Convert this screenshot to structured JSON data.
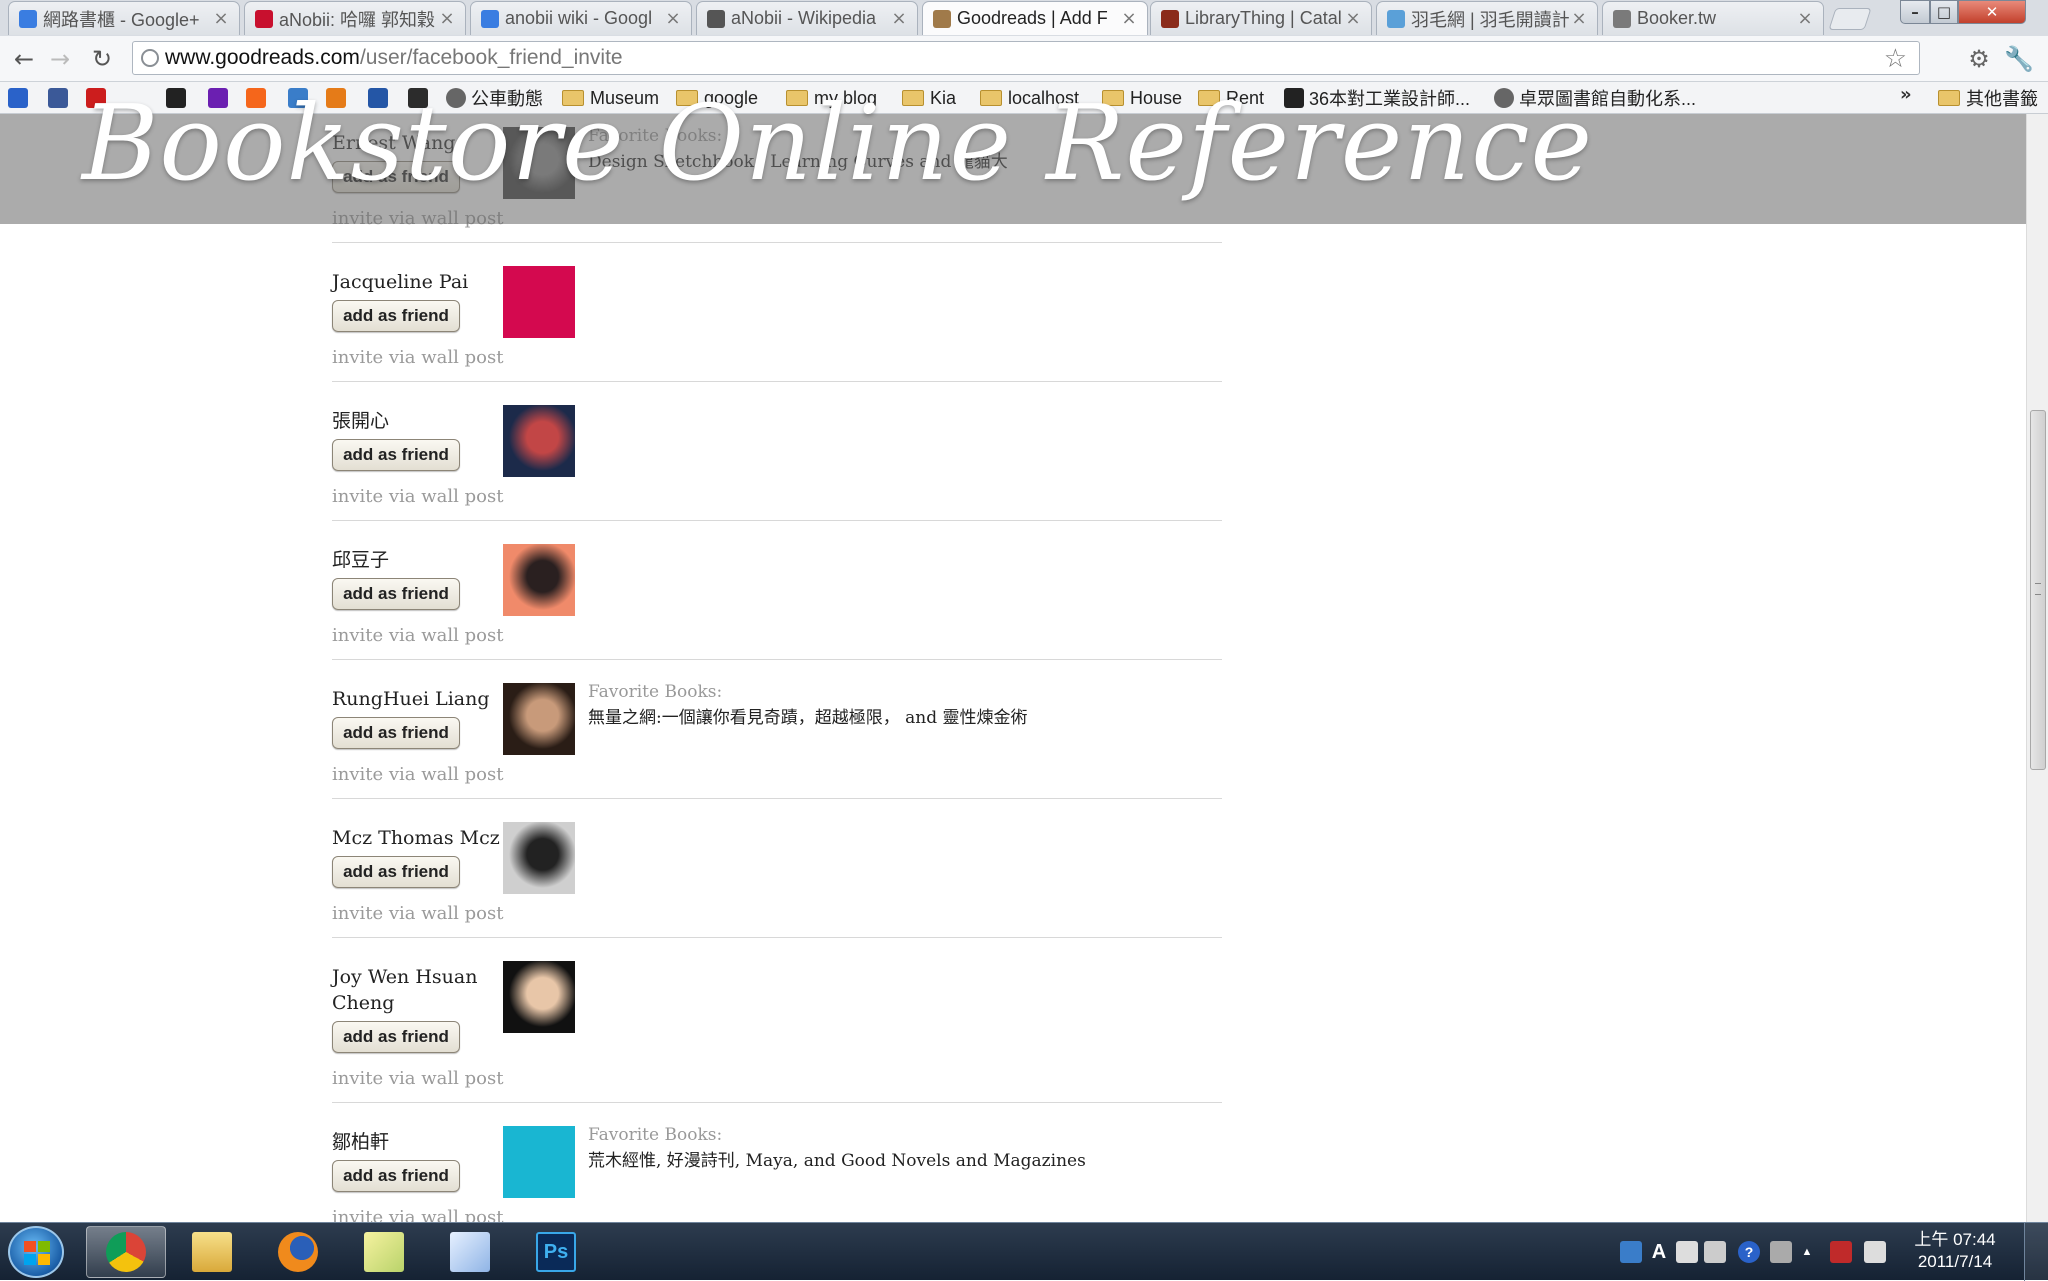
{
  "browser": {
    "tabs": [
      {
        "title": "網路書櫃 - Google+",
        "favicon": "google-icon",
        "color": "#3a7de1"
      },
      {
        "title": "aNobii: 哈囉 郭知穀",
        "favicon": "anobii-icon",
        "color": "#c8102e"
      },
      {
        "title": "anobii wiki - Googl",
        "favicon": "google-icon",
        "color": "#3a7de1"
      },
      {
        "title": "aNobii - Wikipedia",
        "favicon": "wikipedia-icon",
        "color": "#555555"
      },
      {
        "title": "Goodreads | Add F",
        "favicon": "goodreads-icon",
        "color": "#a07a4a",
        "active": true
      },
      {
        "title": "LibraryThing | Catal",
        "favicon": "librarything-icon",
        "color": "#8b2b1a"
      },
      {
        "title": "羽毛網 | 羽毛開讀計",
        "favicon": "feather-icon",
        "color": "#5aa0d8"
      },
      {
        "title": "Booker.tw",
        "favicon": "booker-icon",
        "color": "#7a7a7a"
      }
    ],
    "url_host": "www.goodreads.com",
    "url_path": "/user/facebook_friend_invite",
    "bookmarks": [
      {
        "label": "",
        "icon": "star-bookmark-icon",
        "color": "#2a62c9"
      },
      {
        "label": "",
        "icon": "facebook-icon",
        "color": "#3b5998"
      },
      {
        "label": "",
        "icon": "youtube-icon",
        "color": "#cc1d1d"
      },
      {
        "label": "",
        "icon": "lb-icon",
        "color": "#222222"
      },
      {
        "label": "",
        "icon": "yahoo-icon",
        "color": "#6b1fb1"
      },
      {
        "label": "",
        "icon": "soundcloud-icon",
        "color": "#f5661b"
      },
      {
        "label": "",
        "icon": "feather-bookmark-icon",
        "color": "#3a7dc9"
      },
      {
        "label": "",
        "icon": "fire-icon",
        "color": "#e57b18"
      },
      {
        "label": "",
        "icon": "badge-icon",
        "color": "#2456a6"
      },
      {
        "label": "",
        "icon": "dots-icon",
        "color": "#2c2c2c"
      },
      {
        "label": "公車動態",
        "icon": "globe-bookmark-icon",
        "color": "#666666"
      },
      {
        "label": "Museum",
        "icon": "folder-icon",
        "color": "#e9c56a"
      },
      {
        "label": "google",
        "icon": "folder-icon",
        "color": "#e9c56a"
      },
      {
        "label": "my blog",
        "icon": "folder-icon",
        "color": "#e9c56a"
      },
      {
        "label": "Kia",
        "icon": "folder-icon",
        "color": "#e9c56a"
      },
      {
        "label": "localhost",
        "icon": "folder-icon",
        "color": "#e9c56a"
      },
      {
        "label": "House",
        "icon": "folder-icon",
        "color": "#e9c56a"
      },
      {
        "label": "Rent",
        "icon": "folder-icon",
        "color": "#e9c56a"
      },
      {
        "label": "36本對工業設計師...",
        "icon": "amazon-icon",
        "color": "#222222"
      },
      {
        "label": "卓眾圖書館自動化系...",
        "icon": "globe-bookmark-icon",
        "color": "#666666"
      }
    ],
    "other_bookmarks": "其他書籤"
  },
  "overlay_title": "Bookstore Online Reference",
  "friends": [
    {
      "name": "Ernest Wang",
      "button": "add as friend",
      "invite": "invite via wall post",
      "avatar": {
        "kind": "photo",
        "colors": [
          "#3a3a3a",
          "#8a8a8a"
        ]
      },
      "fav_label": "Favorite Books:",
      "fav_books": "Design Sketchbook , Learning Curves and 龍貓大"
    },
    {
      "name": "Jacqueline Pai",
      "button": "add as friend",
      "invite": "invite via wall post",
      "avatar": {
        "kind": "solid",
        "colors": [
          "#d4094f"
        ]
      }
    },
    {
      "name": "張開心",
      "button": "add as friend",
      "invite": "invite via wall post",
      "avatar": {
        "kind": "photo",
        "colors": [
          "#1c2a4a",
          "#c24646"
        ]
      }
    },
    {
      "name": "邱豆子",
      "button": "add as friend",
      "invite": "invite via wall post",
      "avatar": {
        "kind": "photo",
        "colors": [
          "#f08a6a",
          "#2a2020"
        ]
      }
    },
    {
      "name": "RungHuei Liang",
      "button": "add as friend",
      "invite": "invite via wall post",
      "avatar": {
        "kind": "photo",
        "colors": [
          "#2a1d16",
          "#c89a7a"
        ]
      },
      "fav_label": "Favorite Books:",
      "fav_books": "無量之網:一個讓你看見奇蹟，超越極限， and 靈性煉金術"
    },
    {
      "name": "Mcz Thomas Mcz",
      "button": "add as friend",
      "invite": "invite via wall post",
      "avatar": {
        "kind": "photo",
        "colors": [
          "#cfcfcf",
          "#222222"
        ]
      }
    },
    {
      "name": "Joy Wen Hsuan Cheng",
      "button": "add as friend",
      "invite": "invite via wall post",
      "avatar": {
        "kind": "photo",
        "colors": [
          "#111111",
          "#e8c6a8"
        ]
      }
    },
    {
      "name": "鄒柏軒",
      "button": "add as friend",
      "invite": "invite via wall post",
      "avatar": {
        "kind": "solid",
        "colors": [
          "#19b6d2"
        ]
      },
      "fav_label": "Favorite Books:",
      "fav_books": "荒木經惟, 好漫詩刊, Maya, and Good Novels and Magazines"
    }
  ],
  "taskbar": {
    "apps": [
      {
        "icon": "chrome-icon",
        "active": true
      },
      {
        "icon": "explorer-folder-icon",
        "active": false
      },
      {
        "icon": "firefox-icon",
        "active": false
      },
      {
        "icon": "sticky-notes-icon",
        "active": false
      },
      {
        "icon": "notepad-icon",
        "active": false
      },
      {
        "icon": "photoshop-icon",
        "active": false
      }
    ],
    "photoshop_label": "Ps",
    "tray": [
      "ime-icon",
      "font-a-icon",
      "layout-icon",
      "layout2-icon",
      "help-icon",
      "expand-icon",
      "show-hidden-icon",
      "action-center-icon",
      "network-icon"
    ],
    "clock_time": "上午 07:44",
    "clock_date": "2011/7/14"
  }
}
